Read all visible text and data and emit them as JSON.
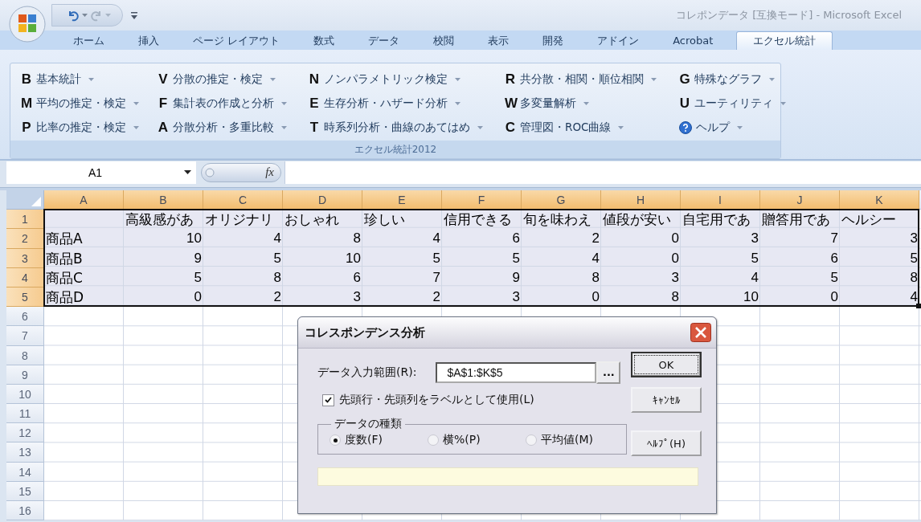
{
  "window": {
    "title": "コレポンデータ [互換モード] - Microsoft Excel"
  },
  "tabs": [
    {
      "label": "ホーム",
      "selected": false
    },
    {
      "label": "挿入",
      "selected": false
    },
    {
      "label": "ページ レイアウト",
      "selected": false
    },
    {
      "label": "数式",
      "selected": false
    },
    {
      "label": "データ",
      "selected": false
    },
    {
      "label": "校閲",
      "selected": false
    },
    {
      "label": "表示",
      "selected": false
    },
    {
      "label": "開発",
      "selected": false
    },
    {
      "label": "アドイン",
      "selected": false
    },
    {
      "label": "Acrobat",
      "selected": false
    },
    {
      "label": "エクセル統計",
      "selected": true
    }
  ],
  "ribbon": {
    "group_label": "エクセル統計2012",
    "columns": [
      [
        {
          "kind": "command",
          "key": "B",
          "label": "基本統計"
        },
        {
          "kind": "command",
          "key": "M",
          "label": "平均の推定・検定"
        },
        {
          "kind": "command",
          "key": "P",
          "label": "比率の推定・検定"
        }
      ],
      [
        {
          "kind": "command",
          "key": "V",
          "label": "分散の推定・検定"
        },
        {
          "kind": "command",
          "key": "F",
          "label": "集計表の作成と分析"
        },
        {
          "kind": "command",
          "key": "A",
          "label": "分散分析・多重比較"
        }
      ],
      [
        {
          "kind": "command",
          "key": "N",
          "label": "ノンパラメトリック検定"
        },
        {
          "kind": "command",
          "key": "E",
          "label": "生存分析・ハザード分析"
        },
        {
          "kind": "command",
          "key": "T",
          "label": "時系列分析・曲線のあてはめ"
        }
      ],
      [
        {
          "kind": "command",
          "key": "R",
          "label": "共分散・相関・順位相関"
        },
        {
          "kind": "command",
          "key": "W",
          "label": "多変量解析"
        },
        {
          "kind": "command",
          "key": "C",
          "label": "管理図・ROC曲線"
        }
      ],
      [
        {
          "kind": "command",
          "key": "G",
          "label": "特殊なグラフ"
        },
        {
          "kind": "command",
          "key": "U",
          "label": "ユーティリティ"
        },
        {
          "kind": "help",
          "label": "ヘルプ"
        }
      ]
    ]
  },
  "formula_bar": {
    "name_box": "A1",
    "function_label": "fx"
  },
  "sheet": {
    "columns": [
      {
        "label": "A",
        "selected": true
      },
      {
        "label": "B",
        "selected": true
      },
      {
        "label": "C",
        "selected": true
      },
      {
        "label": "D",
        "selected": true
      },
      {
        "label": "E",
        "selected": true
      },
      {
        "label": "F",
        "selected": true
      },
      {
        "label": "G",
        "selected": true
      },
      {
        "label": "H",
        "selected": true
      },
      {
        "label": "I",
        "selected": true
      },
      {
        "label": "J",
        "selected": true
      },
      {
        "label": "K",
        "selected": true
      }
    ],
    "rows": [
      {
        "label": "1",
        "selected": true,
        "cells": [
          null,
          "高級感があ",
          "オリジナリ",
          "おしゃれ",
          "珍しい",
          "信用できる",
          "旬を味わえ",
          "値段が安い",
          "自宅用であ",
          "贈答用であ",
          "ヘルシー"
        ]
      },
      {
        "label": "2",
        "selected": true,
        "cells": [
          "商品A",
          "10",
          "4",
          "8",
          "4",
          "6",
          "2",
          "0",
          "3",
          "7",
          "3"
        ]
      },
      {
        "label": "3",
        "selected": true,
        "cells": [
          "商品B",
          "9",
          "5",
          "10",
          "5",
          "5",
          "4",
          "0",
          "5",
          "6",
          "5"
        ]
      },
      {
        "label": "4",
        "selected": true,
        "cells": [
          "商品C",
          "5",
          "8",
          "6",
          "7",
          "9",
          "8",
          "3",
          "4",
          "5",
          "8"
        ]
      },
      {
        "label": "5",
        "selected": true,
        "cells": [
          "商品D",
          "0",
          "2",
          "3",
          "2",
          "3",
          "0",
          "8",
          "10",
          "0",
          "4"
        ]
      },
      {
        "label": "6",
        "selected": false
      },
      {
        "label": "7",
        "selected": false
      },
      {
        "label": "8",
        "selected": false
      },
      {
        "label": "9",
        "selected": false
      },
      {
        "label": "10",
        "selected": false
      },
      {
        "label": "11",
        "selected": false
      },
      {
        "label": "12",
        "selected": false
      },
      {
        "label": "13",
        "selected": false
      },
      {
        "label": "14",
        "selected": false
      },
      {
        "label": "15",
        "selected": false
      },
      {
        "label": "16",
        "selected": false
      }
    ]
  },
  "dialog": {
    "title": "コレスポンデンス分析",
    "range_label": "データ入力範囲(R):",
    "range_value": "$A$1:$K$5",
    "browse_button": "...",
    "checkbox": {
      "label": "先頭行・先頭列をラベルとして使用(L)",
      "checked": true
    },
    "group_title": "データの種類",
    "radios": [
      {
        "label": "度数(F)",
        "selected": true
      },
      {
        "label": "横%(P)",
        "selected": false
      },
      {
        "label": "平均値(M)",
        "selected": false
      }
    ],
    "buttons": [
      {
        "label": "OK",
        "focused": true
      },
      {
        "label": "ｷｬﾝｾﾙ",
        "focused": false
      },
      {
        "label": "ﾍﾙﾌﾟ(H)",
        "focused": false
      }
    ]
  }
}
